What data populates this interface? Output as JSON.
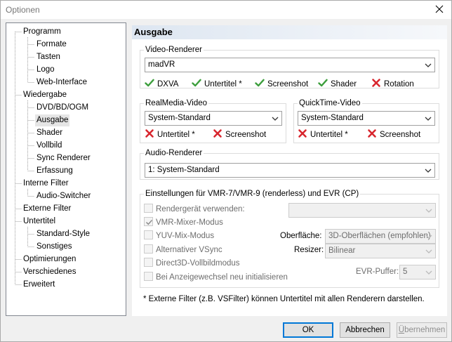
{
  "window": {
    "title": "Optionen",
    "close_icon": "close-icon"
  },
  "tree": {
    "items": [
      {
        "label": "Programm",
        "level": 0
      },
      {
        "label": "Formate",
        "level": 1
      },
      {
        "label": "Tasten",
        "level": 1
      },
      {
        "label": "Logo",
        "level": 1
      },
      {
        "label": "Web-Interface",
        "level": 1
      },
      {
        "label": "Wiedergabe",
        "level": 0
      },
      {
        "label": "DVD/BD/OGM",
        "level": 1
      },
      {
        "label": "Ausgabe",
        "level": 1,
        "selected": true
      },
      {
        "label": "Shader",
        "level": 1
      },
      {
        "label": "Vollbild",
        "level": 1
      },
      {
        "label": "Sync Renderer",
        "level": 1
      },
      {
        "label": "Erfassung",
        "level": 1
      },
      {
        "label": "Interne Filter",
        "level": 0
      },
      {
        "label": "Audio-Switcher",
        "level": 1
      },
      {
        "label": "Externe Filter",
        "level": 0
      },
      {
        "label": "Untertitel",
        "level": 0
      },
      {
        "label": "Standard-Style",
        "level": 1
      },
      {
        "label": "Sonstiges",
        "level": 1
      },
      {
        "label": "Optimierungen",
        "level": 0
      },
      {
        "label": "Verschiedenes",
        "level": 0
      },
      {
        "label": "Erweitert",
        "level": 0
      }
    ]
  },
  "page": {
    "header": "Ausgabe"
  },
  "video_renderer": {
    "title": "Video-Renderer",
    "selected": "madVR",
    "features": [
      {
        "label": "DXVA",
        "status": "ok"
      },
      {
        "label": "Untertitel *",
        "status": "ok"
      },
      {
        "label": "Screenshot",
        "status": "ok"
      },
      {
        "label": "Shader",
        "status": "ok"
      },
      {
        "label": "Rotation",
        "status": "fail"
      }
    ]
  },
  "realmedia": {
    "title": "RealMedia-Video",
    "selected": "System-Standard",
    "features": [
      {
        "label": "Untertitel *",
        "status": "fail"
      },
      {
        "label": "Screenshot",
        "status": "fail"
      }
    ]
  },
  "quicktime": {
    "title": "QuickTime-Video",
    "selected": "System-Standard",
    "features": [
      {
        "label": "Untertitel *",
        "status": "fail"
      },
      {
        "label": "Screenshot",
        "status": "fail"
      }
    ]
  },
  "audio_renderer": {
    "title": "Audio-Renderer",
    "selected": "1: System-Standard"
  },
  "vmr": {
    "title": "Einstellungen für VMR-7/VMR-9 (renderless) und EVR (CP)",
    "checkboxes": [
      {
        "label": "Rendergerät verwenden:",
        "checked": false
      },
      {
        "label": "VMR-Mixer-Modus",
        "checked": true
      },
      {
        "label": "YUV-Mix-Modus",
        "checked": false
      },
      {
        "label": "Alternativer VSync",
        "checked": false
      },
      {
        "label": "Direct3D-Vollbildmodus",
        "checked": false
      },
      {
        "label": "Bei Anzeigewechsel neu initialisieren",
        "checked": false
      }
    ],
    "render_device": "",
    "surface_label": "Oberfläche:",
    "surface_value": "3D-Oberflächen (empfohlen)",
    "resizer_label": "Resizer:",
    "resizer_value": "Bilinear",
    "evr_label": "EVR-Puffer:",
    "evr_value": "5"
  },
  "footnote": "* Externe Filter (z.B. VSFilter) können Untertitel mit allen Renderern darstellen.",
  "buttons": {
    "ok": "OK",
    "cancel": "Abbrechen",
    "apply_first": "Ü",
    "apply_rest": "bernehmen"
  },
  "colors": {
    "ok_green": "#3c9e3c",
    "fail_red": "#d8262e",
    "header_gradient": "#dde6f1",
    "focus_blue": "#0078d7"
  }
}
